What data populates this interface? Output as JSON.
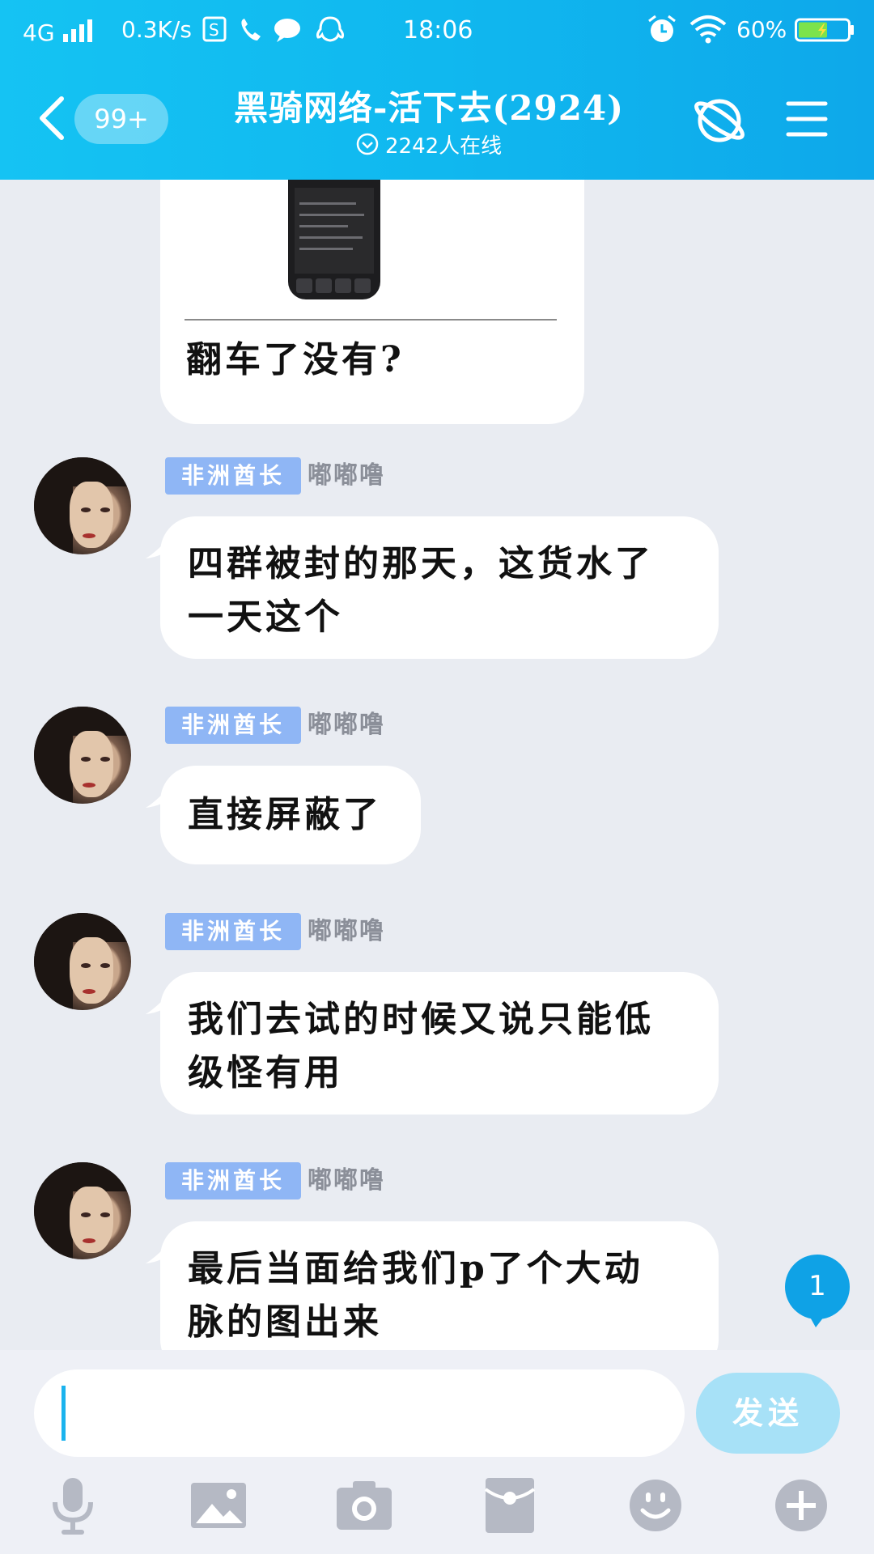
{
  "status_bar": {
    "network": "4G",
    "speed": "0.3K/s",
    "time": "18:06",
    "battery_percent": "60%",
    "battery_level": 0.6,
    "icons": [
      "storage-app-icon",
      "phone-call-icon",
      "chat-bubble-icon",
      "qq-penguin-icon",
      "alarm-icon",
      "wifi-icon",
      "battery-icon"
    ]
  },
  "header": {
    "back_icon": "chevron-left-icon",
    "unread_count": "99+",
    "title": "黑骑网络-活下去(2924)",
    "online_text": "2242人在线",
    "online_icon": "chevron-circle-down-icon",
    "right_icons": [
      "no-planet-icon",
      "menu-icon"
    ]
  },
  "messages": [
    {
      "type": "image_text",
      "text": "翻车了没有?"
    },
    {
      "badge": "非洲酋长",
      "sender": "嘟嘟噜",
      "text_lines": [
        "四群被封的那天，这货水了",
        "一天这个"
      ]
    },
    {
      "badge": "非洲酋长",
      "sender": "嘟嘟噜",
      "text_lines": [
        "直接屏蔽了"
      ]
    },
    {
      "badge": "非洲酋长",
      "sender": "嘟嘟噜",
      "text_lines": [
        "我们去试的时候又说只能低",
        "级怪有用"
      ]
    },
    {
      "badge": "非洲酋长",
      "sender": "嘟嘟噜",
      "text_lines": [
        "最后当面给我们p了个大动",
        "脉的图出来"
      ]
    }
  ],
  "new_message_count": "1",
  "input": {
    "value": "",
    "placeholder": "",
    "send_label": "发送"
  },
  "toolbar": [
    "microphone-icon",
    "image-icon",
    "camera-icon",
    "red-packet-icon",
    "emoji-icon",
    "plus-icon"
  ],
  "colors": {
    "header_start": "#15c3f3",
    "header_end": "#0ea8ea",
    "chat_bg": "#e9ecf2",
    "badge_bg": "#8fb6f5",
    "send_button": "#a7e1f7",
    "accent": "#0fa2e6"
  }
}
